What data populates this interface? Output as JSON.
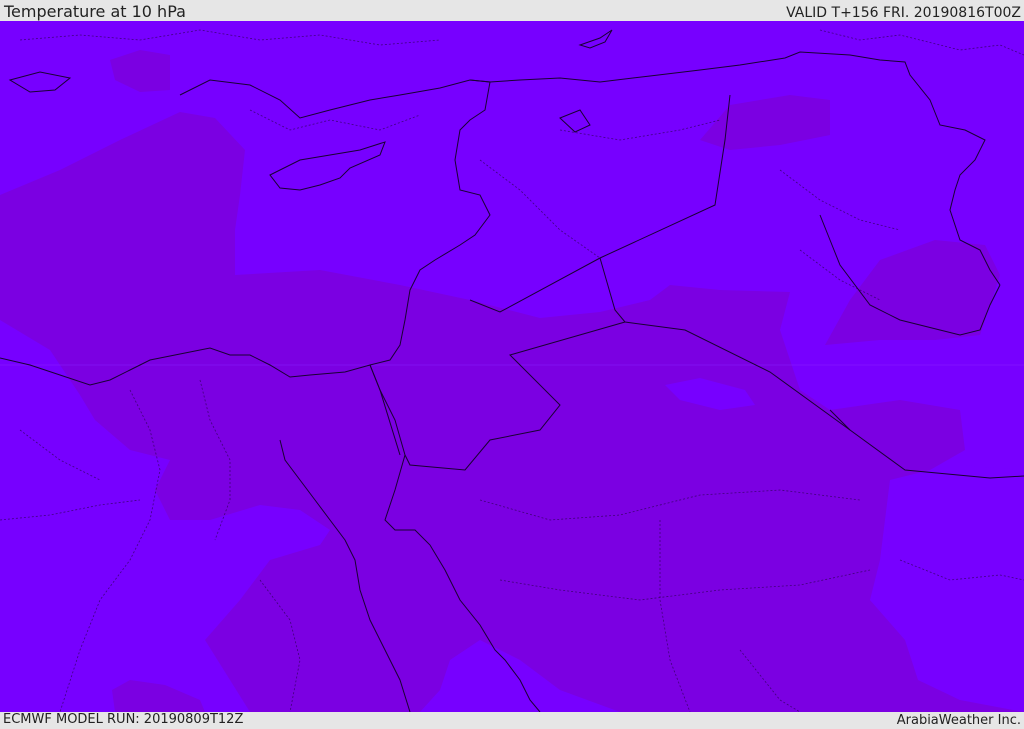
{
  "header": {
    "title": "Temperature at 10 hPa",
    "valid": "VALID T+156 FRI. 20190816T00Z"
  },
  "footer": {
    "model_run": "ECMWF MODEL RUN: 20190809T12Z",
    "credit": "ArabiaWeather Inc."
  },
  "map": {
    "fill_light": "#7700ff",
    "fill_dark": "#7b00e2",
    "coast_color": "#1a0033"
  }
}
